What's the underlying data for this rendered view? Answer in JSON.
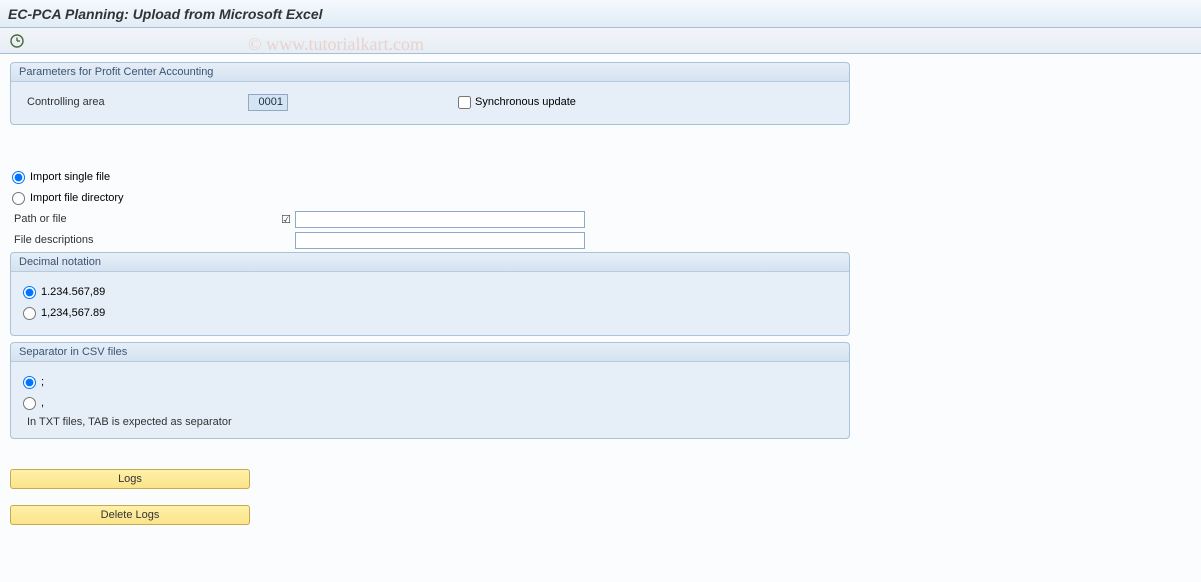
{
  "title": "EC-PCA Planning: Upload from Microsoft Excel",
  "watermark": "© www.tutorialkart.com",
  "group_params": {
    "title": "Parameters for Profit Center Accounting",
    "controlling_area_label": "Controlling area",
    "controlling_area_value": "0001",
    "sync_update_label": "Synchronous update"
  },
  "import": {
    "single_file_label": "Import single file",
    "directory_label": "Import file directory",
    "path_label": "Path or file",
    "path_value": "",
    "filedesc_label": "File descriptions",
    "filedesc_value": ""
  },
  "decimal": {
    "title": "Decimal notation",
    "opt1": "1.234.567,89",
    "opt2": "1,234,567.89"
  },
  "separator": {
    "title": "Separator in CSV files",
    "opt1": ";",
    "opt2": ",",
    "note": "In TXT files, TAB is expected as separator"
  },
  "buttons": {
    "logs": "Logs",
    "delete_logs": "Delete Logs"
  }
}
